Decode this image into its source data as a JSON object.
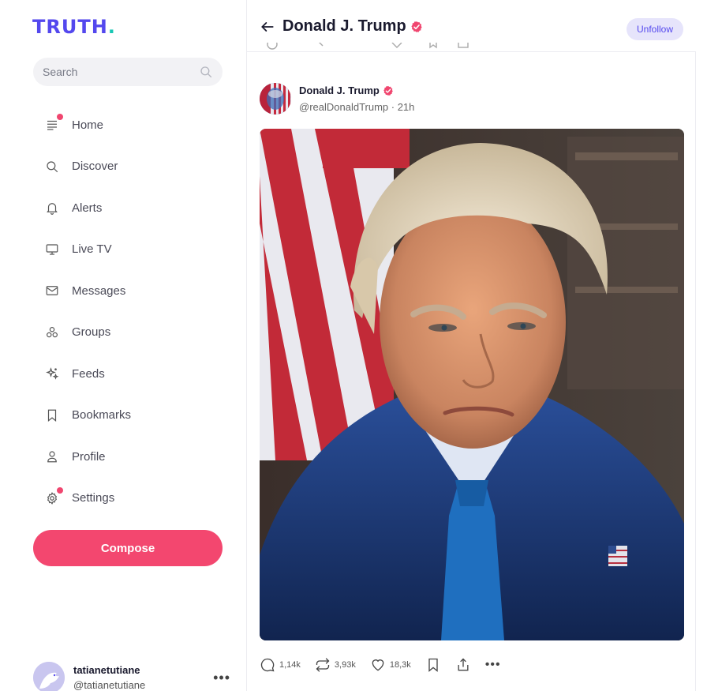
{
  "brand": {
    "logo_text": "TRUTH",
    "logo_dot": ".",
    "colors": {
      "primary": "#5448ee",
      "accent": "#17c7b4",
      "compose": "#f3476f"
    }
  },
  "search": {
    "placeholder": "Search"
  },
  "nav": {
    "items": [
      {
        "label": "Home",
        "icon": "home-icon",
        "badge": true
      },
      {
        "label": "Discover",
        "icon": "search-icon",
        "badge": false
      },
      {
        "label": "Alerts",
        "icon": "bell-icon",
        "badge": false
      },
      {
        "label": "Live TV",
        "icon": "tv-icon",
        "badge": false
      },
      {
        "label": "Messages",
        "icon": "mail-icon",
        "badge": false
      },
      {
        "label": "Groups",
        "icon": "groups-icon",
        "badge": false
      },
      {
        "label": "Feeds",
        "icon": "sparkle-icon",
        "badge": false
      },
      {
        "label": "Bookmarks",
        "icon": "bookmark-icon",
        "badge": false
      },
      {
        "label": "Profile",
        "icon": "user-icon",
        "badge": false
      },
      {
        "label": "Settings",
        "icon": "gear-icon",
        "badge": true
      }
    ]
  },
  "compose": {
    "label": "Compose"
  },
  "account": {
    "name": "tatianetutiane",
    "handle": "@tatianetutiane",
    "more": "•••"
  },
  "header": {
    "title": "Donald J. Trump",
    "unfollow_label": "Unfollow"
  },
  "post": {
    "author_name": "Donald J. Trump",
    "author_handle": "@realDonaldTrump",
    "age": "21h",
    "meta": "@realDonaldTrump · 21h",
    "actions": {
      "replies": "1,14k",
      "retruths": "3,93k",
      "likes": "18,3k",
      "more": "•••"
    }
  }
}
